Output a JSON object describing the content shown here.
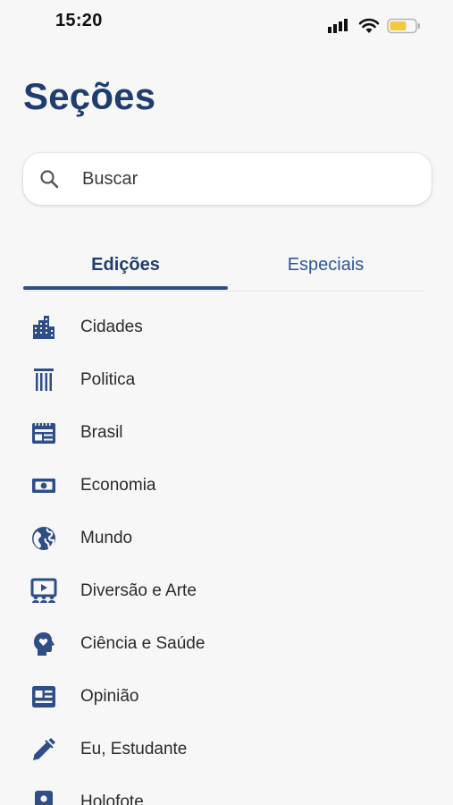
{
  "status": {
    "time": "15:20"
  },
  "page_title": "Seções",
  "search": {
    "placeholder": "Buscar"
  },
  "tabs": [
    {
      "label": "Edições",
      "selected": true
    },
    {
      "label": "Especiais",
      "selected": false
    }
  ],
  "sections": [
    {
      "label": "Cidades",
      "icon": "city-buildings-icon"
    },
    {
      "label": "Politica",
      "icon": "columns-pillar-icon"
    },
    {
      "label": "Brasil",
      "icon": "newspaper-calendar-icon"
    },
    {
      "label": "Economia",
      "icon": "money-bill-icon"
    },
    {
      "label": "Mundo",
      "icon": "globe-icon"
    },
    {
      "label": "Diversão e Arte",
      "icon": "theater-screen-icon"
    },
    {
      "label": "Ciência e Saúde",
      "icon": "head-heart-icon"
    },
    {
      "label": "Opinião",
      "icon": "news-article-icon"
    },
    {
      "label": "Eu, Estudante",
      "icon": "pencil-icon"
    },
    {
      "label": "Holofote",
      "icon": "contact-badge-icon"
    }
  ],
  "colors": {
    "accent": "#2e4e85",
    "title": "#1f3d6e",
    "background": "#f7f7f8",
    "battery": "#f2c93b"
  }
}
